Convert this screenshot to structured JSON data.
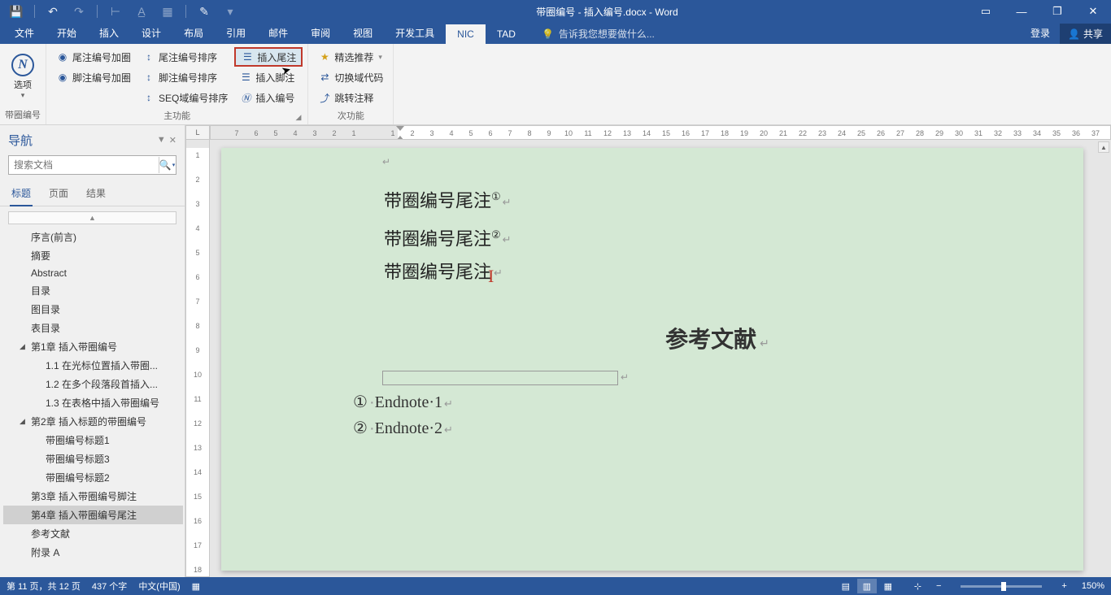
{
  "titlebar": {
    "title": "带圈编号 - 插入编号.docx - Word",
    "qat": {
      "save": "💾",
      "undo": "↶",
      "redo": "↷"
    }
  },
  "window_controls": {
    "ribbon_opts": "▭",
    "minimize": "—",
    "restore": "❐",
    "close": "✕"
  },
  "ribbon": {
    "tabs": [
      "文件",
      "开始",
      "插入",
      "设计",
      "布局",
      "引用",
      "邮件",
      "审阅",
      "视图",
      "开发工具",
      "NIC",
      "TAD"
    ],
    "active_tab": "NIC",
    "tell_me": "告诉我您想要做什么...",
    "login": "登录",
    "share": "共享",
    "groups": {
      "g1": {
        "label": "带圈编号",
        "options_btn": "选项"
      },
      "g2": {
        "label": "主功能",
        "col1": [
          "尾注编号加圈",
          "脚注编号加圈"
        ],
        "col2": [
          "尾注编号排序",
          "脚注编号排序",
          "SEQ域编号排序"
        ],
        "col3": [
          "插入尾注",
          "插入脚注",
          "插入编号"
        ]
      },
      "g3": {
        "label": "次功能",
        "items": [
          "精选推荐",
          "切换域代码",
          "跳转注释"
        ]
      }
    }
  },
  "navpane": {
    "title": "导航",
    "search_placeholder": "搜索文档",
    "tabs": [
      "标题",
      "页面",
      "结果"
    ],
    "active_tab": "标题",
    "tree": [
      {
        "lvl": 0,
        "label": "序言(前言)"
      },
      {
        "lvl": 0,
        "label": "摘要"
      },
      {
        "lvl": 0,
        "label": "Abstract"
      },
      {
        "lvl": 0,
        "label": "目录"
      },
      {
        "lvl": 0,
        "label": "图目录"
      },
      {
        "lvl": 0,
        "label": "表目录"
      },
      {
        "lvl": 1,
        "label": "第1章 插入带圈编号",
        "exp": true
      },
      {
        "lvl": 2,
        "label": "1.1 在光标位置插入带圈..."
      },
      {
        "lvl": 2,
        "label": "1.2 在多个段落段首插入..."
      },
      {
        "lvl": 2,
        "label": "1.3 在表格中插入带圈编号"
      },
      {
        "lvl": 1,
        "label": "第2章 插入标题的带圈编号",
        "exp": true
      },
      {
        "lvl": 2,
        "label": "带圈编号标题1"
      },
      {
        "lvl": 2,
        "label": "带圈编号标题3"
      },
      {
        "lvl": 2,
        "label": "带圈编号标题2"
      },
      {
        "lvl": 0,
        "label": "第3章 插入带圈编号脚注"
      },
      {
        "lvl": 0,
        "label": "第4章 插入带圈编号尾注",
        "sel": true
      },
      {
        "lvl": 0,
        "label": "参考文献"
      },
      {
        "lvl": 0,
        "label": "附录 A"
      }
    ]
  },
  "ruler": {
    "corner": "L",
    "h_left": [
      "7",
      "6",
      "5",
      "4",
      "3",
      "2",
      "1"
    ],
    "h_right": [
      "1",
      "2",
      "3",
      "4",
      "5",
      "6",
      "7",
      "8",
      "9",
      "10",
      "11",
      "12",
      "13",
      "14",
      "15",
      "16",
      "17",
      "18",
      "19",
      "20",
      "21",
      "22",
      "23",
      "24",
      "25",
      "26",
      "27",
      "28",
      "29",
      "30",
      "31",
      "32",
      "33",
      "34",
      "35",
      "36",
      "37"
    ],
    "v": [
      "1",
      "2",
      "3",
      "4",
      "5",
      "6",
      "7",
      "8",
      "9",
      "10",
      "11",
      "12",
      "13",
      "14",
      "15",
      "16",
      "17",
      "18"
    ]
  },
  "document": {
    "lines": [
      {
        "text": "带圈编号尾注",
        "sup": "①"
      },
      {
        "text": "带圈编号尾注",
        "sup": "②"
      },
      {
        "text": "带圈编号尾注",
        "cursor": true
      }
    ],
    "refs_title": "参考文献",
    "endnotes": [
      {
        "num": "①",
        "text": "Endnote·1"
      },
      {
        "num": "②",
        "text": "Endnote·2"
      }
    ]
  },
  "statusbar": {
    "page": "第 11 页，共 12 页",
    "words": "437 个字",
    "lang": "中文(中国)",
    "zoom": "150%"
  }
}
